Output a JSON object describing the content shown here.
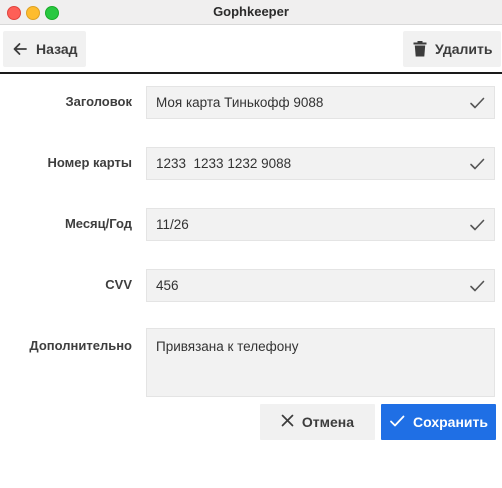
{
  "window": {
    "title": "Gophkeeper"
  },
  "toolbar": {
    "back_label": "Назад",
    "delete_label": "Удалить"
  },
  "form": {
    "fields": [
      {
        "label": "Заголовок",
        "value": "Моя карта Тинькофф 9088"
      },
      {
        "label": "Номер карты",
        "value": "1233  1233 1232 9088"
      },
      {
        "label": "Месяц/Год",
        "value": "11/26"
      },
      {
        "label": "CVV",
        "value": "456"
      }
    ],
    "notes": {
      "label": "Дополнительно",
      "value": "Привязана к телефону"
    }
  },
  "actions": {
    "cancel_label": "Отмена",
    "save_label": "Сохранить"
  },
  "colors": {
    "accent": "#1f6fe5",
    "close": "#fe5f57",
    "minimize": "#febc2e",
    "maximize": "#28c840"
  },
  "icons": {
    "back": "arrow-left-icon",
    "delete": "trash-icon",
    "field_valid": "checkmark-icon",
    "cancel": "close-icon",
    "save": "checkmark-icon"
  }
}
